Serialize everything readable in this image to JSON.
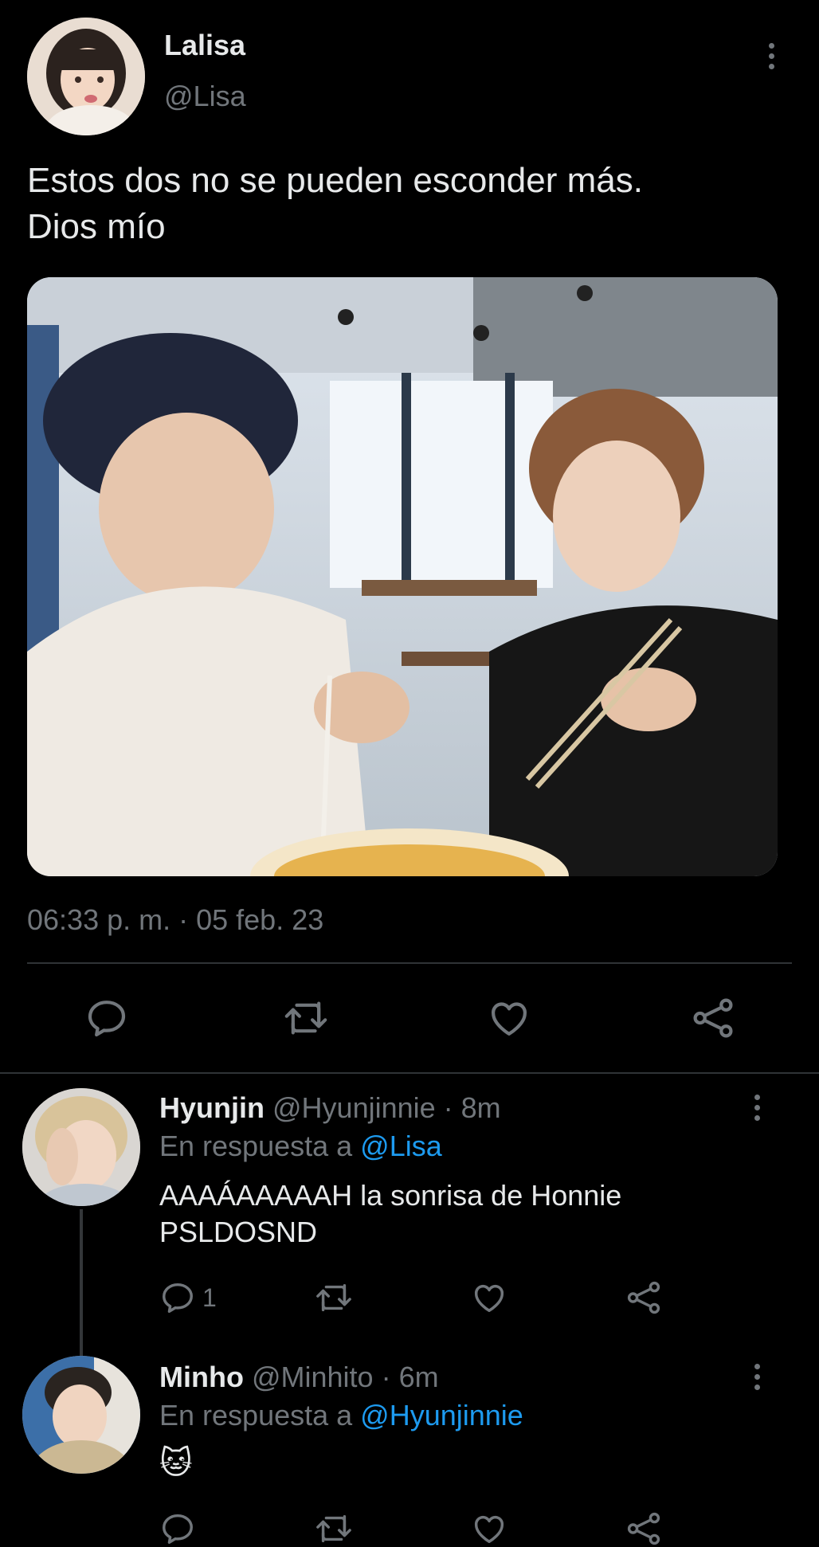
{
  "tweet": {
    "author_name": "Lalisa",
    "author_handle": "@Lisa",
    "text_line1": "Estos dos no se pueden esconder más.",
    "text_line2": "Dios mío",
    "timestamp": "06:33 p. m. · 05 feb. 23",
    "actions": [
      "reply-icon",
      "retweet-icon",
      "like-icon",
      "share-icon"
    ]
  },
  "replies": [
    {
      "name": "Hyunjin",
      "handle": "@Hyunjinnie · 8m",
      "reply_prefix": "En respuesta a",
      "reply_to": "@Lisa",
      "text_line1": "AAAÁAAAAAH la sonrisa de Honnie",
      "text_line2": "PSLDOSND",
      "reply_count": "1"
    },
    {
      "name": "Minho",
      "handle": "@Minhito · 6m",
      "reply_prefix": "En respuesta a",
      "reply_to": "@Hyunjinnie",
      "text_line1": "🐱"
    }
  ],
  "colors": {
    "background": "#000000",
    "text": "#e7e9ea",
    "muted": "#71767b",
    "accent": "#1d9bf0"
  }
}
